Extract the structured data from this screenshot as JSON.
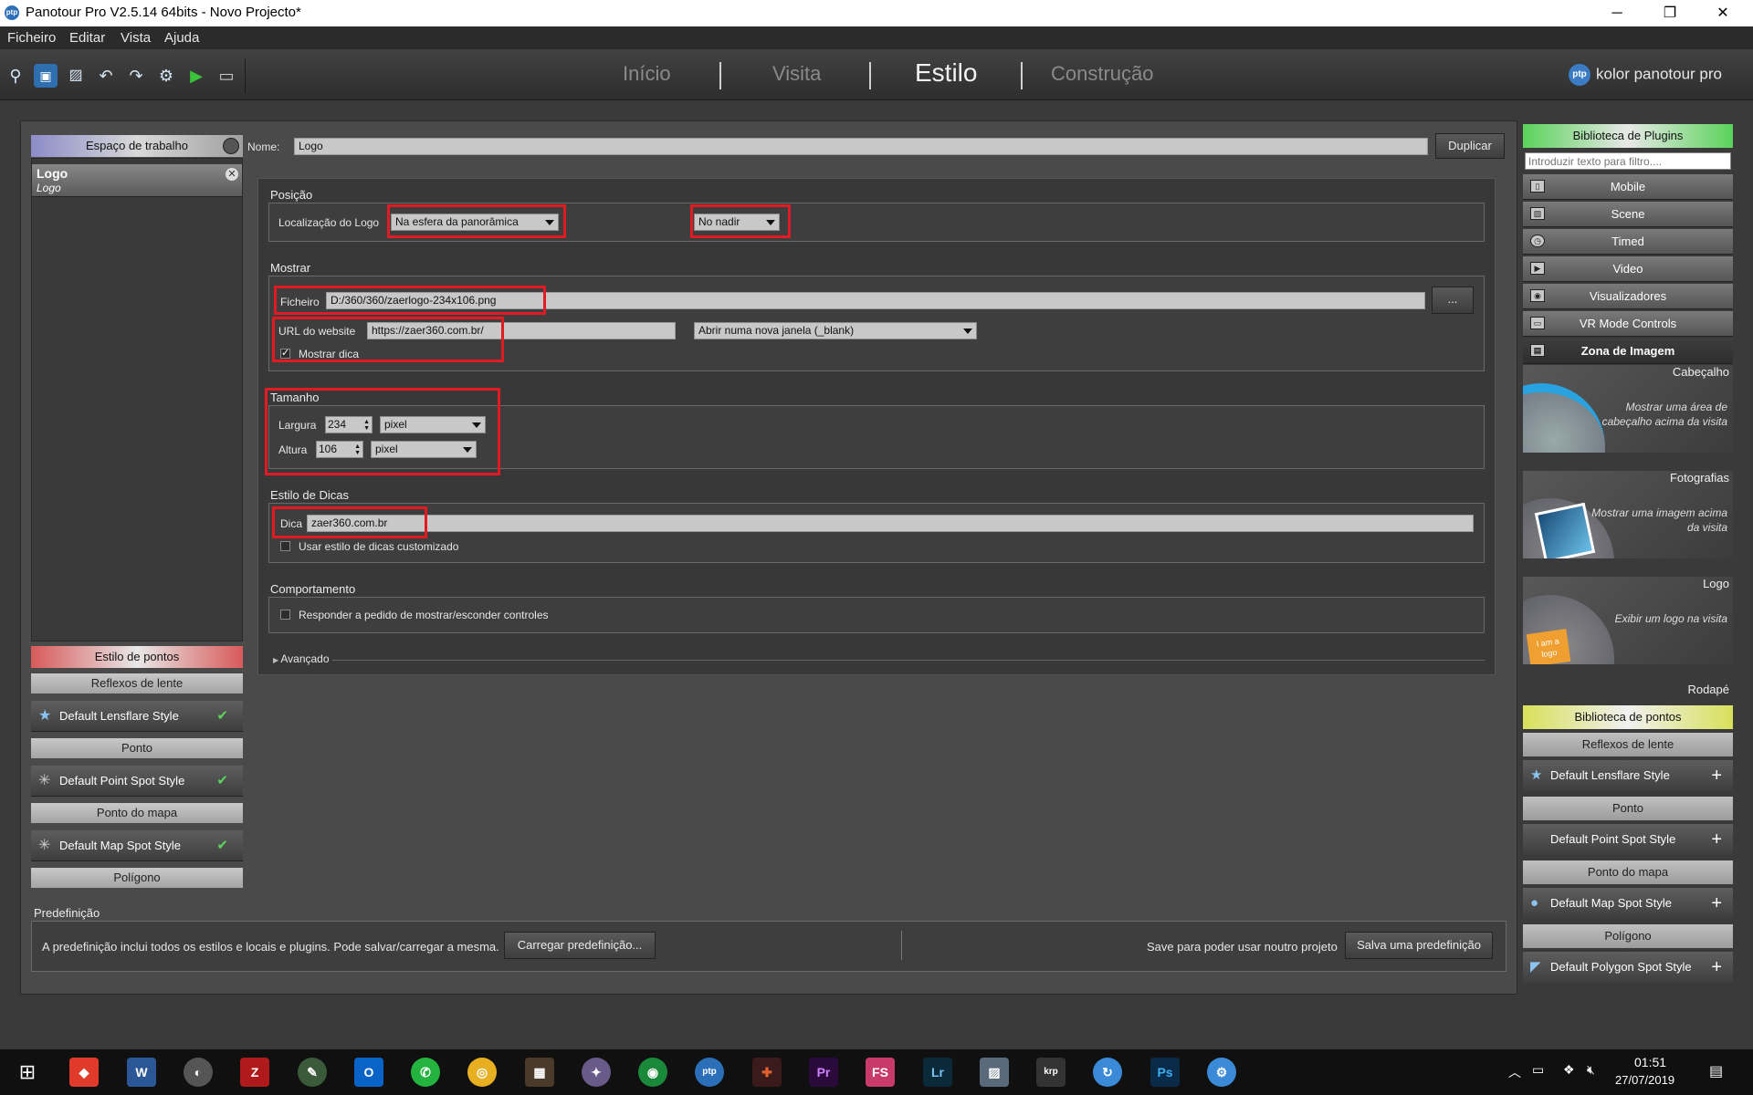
{
  "window": {
    "title": "Panotour Pro V2.5.14 64bits - Novo Projecto*",
    "app_badge": "ptp",
    "minimize": "─",
    "restore": "❐",
    "close": "✕"
  },
  "menu": [
    "Ficheiro",
    "Editar",
    "Vista",
    "Ajuda"
  ],
  "nav": {
    "tabs": [
      "Início",
      "Visita",
      "Estilo",
      "Construção"
    ],
    "active": "Estilo",
    "brand": "kolor panotour pro",
    "brand_badge": "ptp"
  },
  "workspace": {
    "header": "Espaço de trabalho",
    "item_name": "Logo",
    "item_sub": "Logo"
  },
  "editor": {
    "name_label": "Nome:",
    "name_value": "Logo",
    "duplicate": "Duplicar",
    "position": {
      "title": "Posição",
      "logo_location_label": "Localização do Logo",
      "logo_location_value": "Na esfera da panorâmica",
      "nadir_value": "No nadir"
    },
    "show": {
      "title": "Mostrar",
      "file_label": "Ficheiro",
      "file_value": "D:/360/360/zaerlogo-234x106.png",
      "browse": "...",
      "url_label": "URL do website",
      "url_value": "https://zaer360.com.br/",
      "target_value": "Abrir numa nova janela (_blank)",
      "show_tip_label": "Mostrar dica"
    },
    "size": {
      "title": "Tamanho",
      "width_label": "Largura",
      "width_value": "234",
      "width_unit": "pixel",
      "height_label": "Altura",
      "height_value": "106",
      "height_unit": "pixel"
    },
    "tips": {
      "title": "Estilo de Dicas",
      "tip_label": "Dica",
      "tip_value": "zaer360.com.br",
      "custom_label": "Usar estilo de dicas customizado"
    },
    "behavior": {
      "title": "Comportamento",
      "respond_label": "Responder a pedido de mostrar/esconder controles"
    },
    "advanced": "Avançado"
  },
  "points_style": {
    "header": "Estilo de pontos",
    "groups": [
      {
        "title": "Reflexos de lente",
        "item": "Default Lensflare Style"
      },
      {
        "title": "Ponto",
        "item": "Default Point Spot Style"
      },
      {
        "title": "Ponto do mapa",
        "item": "Default Map Spot Style"
      },
      {
        "title": "Polígono"
      }
    ]
  },
  "preset": {
    "title": "Predefinição",
    "desc": "A predefinição inclui todos os estilos e locais e plugins. Pode salvar/carregar a mesma.",
    "load": "Carregar predefinição...",
    "save_desc": "Save para poder usar noutro projeto",
    "save": "Salva uma predefinição"
  },
  "plugins": {
    "header": "Biblioteca de Plugins",
    "filter_placeholder": "Introduzir texto para filtro....",
    "items": [
      "Mobile",
      "Scene",
      "Timed",
      "Video",
      "Visualizadores",
      "VR Mode Controls",
      "Zona de Imagem"
    ],
    "tiles": [
      {
        "cap": "Cabeçalho",
        "desc": "Mostrar uma área de cabeçalho acima da visita"
      },
      {
        "cap": "Fotografias",
        "desc": "Mostrar uma imagem acima da visita"
      },
      {
        "cap": "Logo",
        "desc": "Exibir um logo na visita",
        "badge": "I am a logo"
      },
      {
        "cap": "Rodapé"
      }
    ]
  },
  "points_lib": {
    "header": "Biblioteca de pontos",
    "groups": [
      {
        "title": "Reflexos de lente",
        "item": "Default Lensflare Style"
      },
      {
        "title": "Ponto",
        "item": "Default Point Spot Style"
      },
      {
        "title": "Ponto do mapa",
        "item": "Default Map Spot Style"
      },
      {
        "title": "Polígono",
        "item": "Default Polygon Spot Style"
      }
    ]
  },
  "taskbar": {
    "time": "01:51",
    "date": "27/07/2019"
  },
  "colors": {
    "highlight": "#e01b24",
    "accent": "#3c7cc4"
  }
}
